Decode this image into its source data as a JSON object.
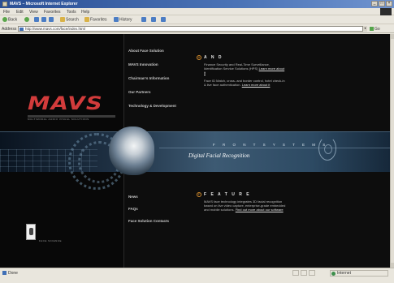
{
  "window": {
    "title": "MAVS – Microsoft Internet Explorer",
    "controls": [
      "_",
      "□",
      "×"
    ]
  },
  "menu": [
    "File",
    "Edit",
    "View",
    "Favorites",
    "Tools",
    "Help"
  ],
  "toolbar": [
    "Back",
    "Search",
    "Favorites",
    "History"
  ],
  "address": {
    "label": "Address",
    "url": "http://www.mavs.com/face/index.html",
    "go": "Go"
  },
  "nav_top": [
    "About Face Solution",
    "MAVS Innovation",
    "Chairman's Information",
    "Our Partners",
    "Technology & Development"
  ],
  "nav_bottom": [
    "News",
    "FAQs",
    "Face Solution Contacts"
  ],
  "sections": {
    "s1": {
      "badge": "A",
      "title": "A N D",
      "body": "Finance Security and Real-Time Surveillance, Identification Service Solutions (HPS)",
      "link": "Learn more about it"
    },
    "s2": {
      "body": "Face ID Match, cross- and border control, hotel check-in & live face authentication.",
      "link": "Learn more about it"
    },
    "s3": {
      "badge": "F",
      "title": "F E A T U R E",
      "body": "MAVS face technology integrates 3D facial recognition based on live video capture, enterprise-grade embedded and mobile solutions.",
      "link": "Find out more about our software"
    }
  },
  "banner": {
    "spaced": "F R O N T   S Y S T E M S",
    "caption": "Digital Facial Recognition"
  },
  "brand": {
    "logo": "MAVS",
    "tagline": "MULTIMODAL AUDIO VISUAL SOLUTIONS",
    "footer": "FACE SCIENCE"
  },
  "status": {
    "text": "Done",
    "zone": "Internet"
  }
}
